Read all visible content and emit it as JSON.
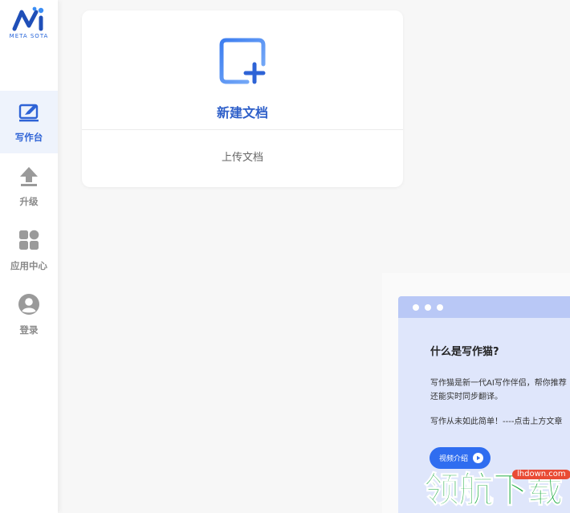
{
  "brand": {
    "logo_text": "META SOTA",
    "accent": "#2e63d6"
  },
  "sidebar": {
    "items": [
      {
        "label": "写作台",
        "icon": "edit-icon",
        "active": true
      },
      {
        "label": "升级",
        "icon": "upload-arrow-icon",
        "active": false
      },
      {
        "label": "应用中心",
        "icon": "apps-grid-icon",
        "active": false
      },
      {
        "label": "登录",
        "icon": "user-avatar-icon",
        "active": false
      }
    ]
  },
  "main": {
    "new_doc_label": "新建文档",
    "upload_label": "上传文档"
  },
  "intro": {
    "title": "什么是写作猫?",
    "line1": "写作猫是新一代AI写作伴侣，帮你推荐",
    "line2": "还能实时同步翻译。",
    "line3": "写作从未如此简单！----点击上方文章",
    "video_button": "视频介绍"
  },
  "watermark": {
    "site": "lhdown.com",
    "text": "领航下载"
  }
}
